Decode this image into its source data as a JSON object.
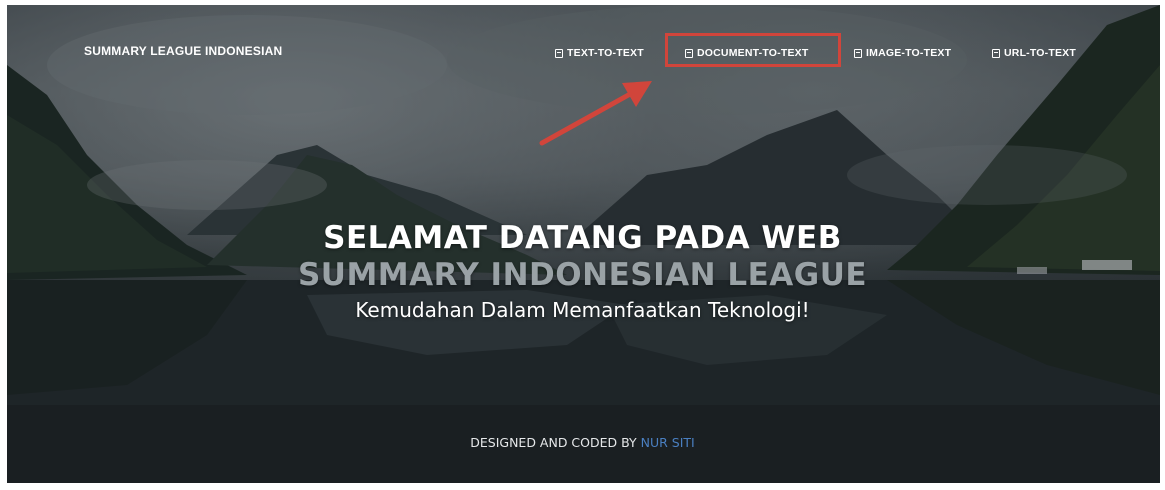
{
  "header": {
    "brand": "SUMMARY LEAGUE INDONESIAN"
  },
  "nav": {
    "items": [
      {
        "label": "TEXT-TO-TEXT",
        "icon": "document-icon"
      },
      {
        "label": "DOCUMENT-TO-TEXT",
        "icon": "document-icon",
        "highlighted": true
      },
      {
        "label": "IMAGE-TO-TEXT",
        "icon": "document-icon"
      },
      {
        "label": "URL-TO-TEXT",
        "icon": "document-icon"
      }
    ]
  },
  "hero": {
    "title": "SELAMAT DATANG PADA WEB",
    "subtitle": "SUMMARY INDONESIAN LEAGUE",
    "tagline": "Kemudahan Dalam Memanfaatkan Teknologi!"
  },
  "footer": {
    "label": "DESIGNED AND CODED BY",
    "author": "NUR SITI"
  },
  "colors": {
    "highlight": "#d1453b",
    "author_link": "#4a7fc1",
    "subtitle": "#9aa2a6"
  }
}
